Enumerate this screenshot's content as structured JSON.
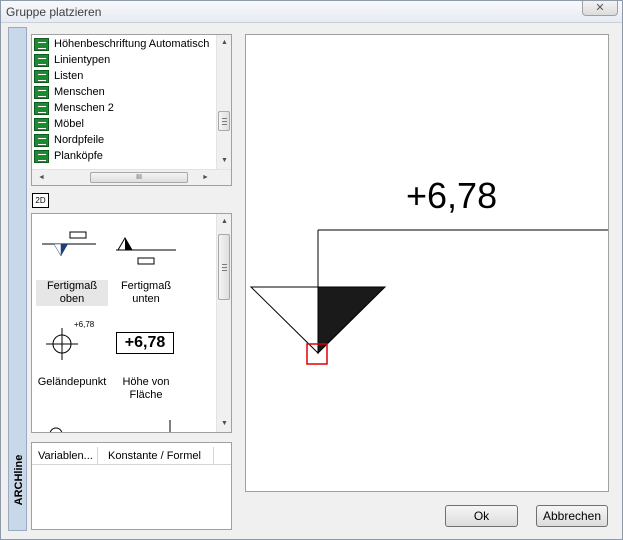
{
  "window": {
    "title": "Gruppe platzieren",
    "close_glyph": "✕"
  },
  "side_panel": {
    "brand": "ARCHline"
  },
  "library_list": {
    "items": [
      {
        "label": "Höhenbeschriftung Automatisch",
        "icon": "library-folder-icon"
      },
      {
        "label": "Linientypen",
        "icon": "library-folder-icon"
      },
      {
        "label": "Listen",
        "icon": "library-folder-icon"
      },
      {
        "label": "Menschen",
        "icon": "library-folder-icon"
      },
      {
        "label": "Menschen 2",
        "icon": "library-folder-icon"
      },
      {
        "label": "Möbel",
        "icon": "library-folder-icon"
      },
      {
        "label": "Nordpfeile",
        "icon": "library-folder-icon"
      },
      {
        "label": "Planköpfe",
        "icon": "library-folder-icon"
      }
    ],
    "scroll_up": "▲",
    "scroll_down": "▼",
    "scroll_left": "◄",
    "scroll_right": "►",
    "hthumb_grip": "III"
  },
  "view_toggle": {
    "label": "2D"
  },
  "symbols": [
    {
      "line1": "Fertigmaß",
      "line2": "oben",
      "selected": true
    },
    {
      "line1": "Fertigmaß",
      "line2": "unten",
      "selected": false
    },
    {
      "line1": "Geländepunkt",
      "line2": "",
      "selected": false,
      "mini_value": "+6,78"
    },
    {
      "line1": "Höhe von",
      "line2": "Fläche",
      "selected": false,
      "box_value": "+6,78"
    }
  ],
  "variables_table": {
    "columns": [
      "Variablen...",
      "Konstante / Formel"
    ]
  },
  "preview": {
    "value": "+6,78",
    "colors": {
      "selection_marker": "#e00000",
      "fill": "#1a1a1a"
    }
  },
  "buttons": {
    "ok": "Ok",
    "cancel": "Abbrechen"
  }
}
